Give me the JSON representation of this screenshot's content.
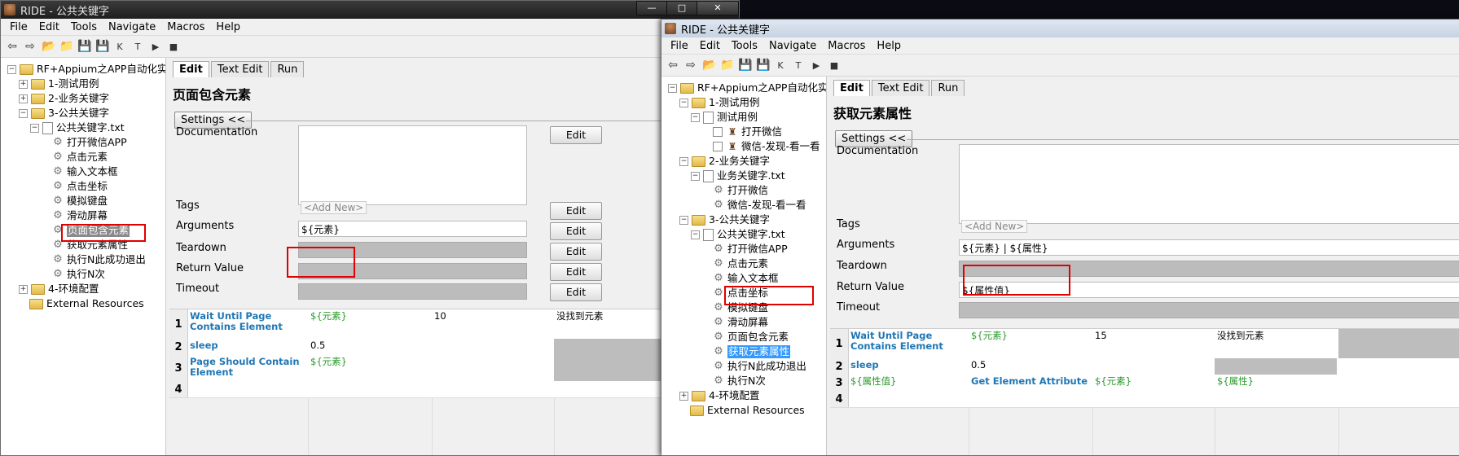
{
  "window1": {
    "title": "RIDE - 公共关键字",
    "controls": {
      "min": "—",
      "max": "□",
      "close": "✕"
    },
    "menu": [
      "File",
      "Edit",
      "Tools",
      "Navigate",
      "Macros",
      "Help"
    ],
    "toolbar_icons": [
      "back-arrow-icon",
      "forward-arrow-icon",
      "open-folder-icon",
      "folder-icon",
      "save-icon",
      "save-all-icon",
      "keyword-search-icon",
      "test-search-icon",
      "run-icon",
      "stop-icon"
    ],
    "toolbar_glyphs": [
      "⇦",
      "⇨",
      "📂",
      "📁",
      "💾",
      "💾",
      "K",
      "T",
      "▶",
      "■"
    ],
    "tree": [
      {
        "label": "RF+Appium之APP自动化实",
        "type": "folder",
        "exp": "−"
      },
      {
        "label": "1-测试用例",
        "type": "folder",
        "exp": "+"
      },
      {
        "label": "2-业务关键字",
        "type": "folder",
        "exp": "+"
      },
      {
        "label": "3-公共关键字",
        "type": "folder",
        "exp": "−"
      },
      {
        "label": "公共关键字.txt",
        "type": "file",
        "exp": "−"
      },
      {
        "label": "打开微信APP",
        "type": "gear"
      },
      {
        "label": "点击元素",
        "type": "gear"
      },
      {
        "label": "输入文本框",
        "type": "gear"
      },
      {
        "label": "点击坐标",
        "type": "gear"
      },
      {
        "label": "模拟键盘",
        "type": "gear"
      },
      {
        "label": "滑动屏幕",
        "type": "gear"
      },
      {
        "label": "页面包含元素",
        "type": "gear",
        "selected": true
      },
      {
        "label": "获取元素属性",
        "type": "gear"
      },
      {
        "label": "执行N此成功退出",
        "type": "gear"
      },
      {
        "label": "执行N次",
        "type": "gear"
      },
      {
        "label": "4-环境配置",
        "type": "folder",
        "exp": "+"
      },
      {
        "label": "External Resources",
        "type": "folder"
      }
    ],
    "tabs": [
      "Edit",
      "Text Edit",
      "Run"
    ],
    "keyword_title": "页面包含元素",
    "settings_label": "Settings <<",
    "labels": {
      "documentation": "Documentation",
      "tags": "Tags",
      "arguments": "Arguments",
      "teardown": "Teardown",
      "return_value": "Return Value",
      "timeout": "Timeout"
    },
    "values": {
      "tags_placeholder": "<Add New>",
      "arguments": "${元素}",
      "return_value": ""
    },
    "edit_label": "Edit",
    "grid": [
      {
        "num": "1",
        "cells": [
          "Wait Until Page Contains Element",
          "${元素}",
          "10",
          "没找到元素"
        ]
      },
      {
        "num": "2",
        "cells": [
          "sleep",
          "0.5",
          "",
          ""
        ]
      },
      {
        "num": "3",
        "cells": [
          "Page Should Contain Element",
          "${元素}",
          "",
          ""
        ]
      },
      {
        "num": "4",
        "cells": [
          "",
          "",
          "",
          ""
        ]
      }
    ]
  },
  "window2": {
    "title": "RIDE - 公共关键字",
    "menu": [
      "File",
      "Edit",
      "Tools",
      "Navigate",
      "Macros",
      "Help"
    ],
    "toolbar_glyphs": [
      "⇦",
      "⇨",
      "📂",
      "📁",
      "💾",
      "💾",
      "K",
      "T",
      "▶",
      "■"
    ],
    "tree": [
      {
        "label": "RF+Appium之APP自动化实践",
        "type": "folder",
        "exp": "−"
      },
      {
        "label": "1-测试用例",
        "type": "folder",
        "exp": "−"
      },
      {
        "label": "测试用例",
        "type": "file",
        "exp": "−"
      },
      {
        "label": "打开微信",
        "type": "robot",
        "check": true
      },
      {
        "label": "微信-发现-看一看",
        "type": "robot",
        "check": true
      },
      {
        "label": "2-业务关键字",
        "type": "folder",
        "exp": "−"
      },
      {
        "label": "业务关键字.txt",
        "type": "file",
        "exp": "−"
      },
      {
        "label": "打开微信",
        "type": "gear"
      },
      {
        "label": "微信-发现-看一看",
        "type": "gear"
      },
      {
        "label": "3-公共关键字",
        "type": "folder",
        "exp": "−"
      },
      {
        "label": "公共关键字.txt",
        "type": "file",
        "exp": "−"
      },
      {
        "label": "打开微信APP",
        "type": "gear"
      },
      {
        "label": "点击元素",
        "type": "gear"
      },
      {
        "label": "输入文本框",
        "type": "gear"
      },
      {
        "label": "点击坐标",
        "type": "gear"
      },
      {
        "label": "模拟键盘",
        "type": "gear"
      },
      {
        "label": "滑动屏幕",
        "type": "gear"
      },
      {
        "label": "页面包含元素",
        "type": "gear"
      },
      {
        "label": "获取元素属性",
        "type": "gear",
        "selected": true
      },
      {
        "label": "执行N此成功退出",
        "type": "gear"
      },
      {
        "label": "执行N次",
        "type": "gear"
      },
      {
        "label": "4-环境配置",
        "type": "folder",
        "exp": "+"
      },
      {
        "label": "External Resources",
        "type": "folder"
      }
    ],
    "tabs": [
      "Edit",
      "Text Edit",
      "Run"
    ],
    "keyword_title": "获取元素属性",
    "settings_label": "Settings <<",
    "labels": {
      "documentation": "Documentation",
      "tags": "Tags",
      "arguments": "Arguments",
      "teardown": "Teardown",
      "return_value": "Return Value",
      "timeout": "Timeout"
    },
    "values": {
      "tags_placeholder": "<Add New>",
      "arguments": "${元素} | ${属性}",
      "return_value": "${属性值}"
    },
    "grid": [
      {
        "num": "1",
        "cells": [
          "Wait Until Page Contains Element",
          "${元素}",
          "15",
          "没找到元素"
        ]
      },
      {
        "num": "2",
        "cells": [
          "sleep",
          "0.5",
          "",
          ""
        ]
      },
      {
        "num": "3",
        "cells": [
          "${属性值}",
          "Get Element Attribute",
          "${元素}",
          "${属性}"
        ]
      },
      {
        "num": "4",
        "cells": [
          "",
          "",
          "",
          ""
        ]
      }
    ]
  }
}
